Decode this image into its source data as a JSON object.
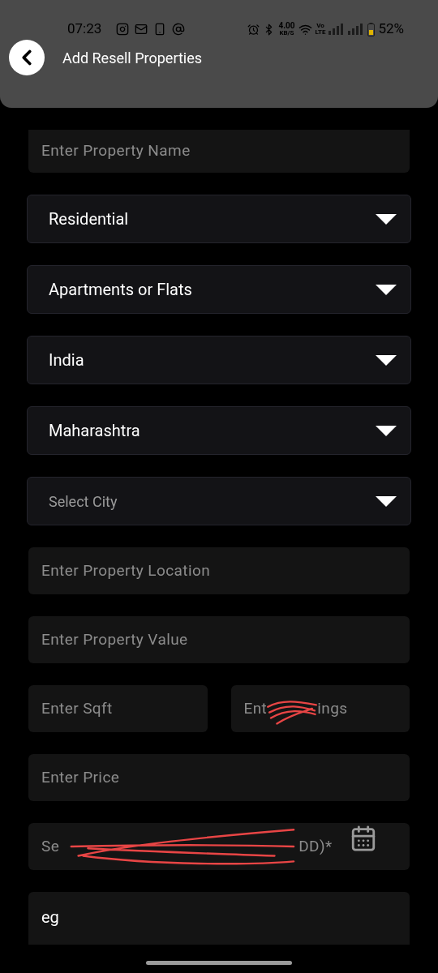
{
  "status_bar": {
    "time": "07:23",
    "speed_value": "4.00",
    "speed_unit": "KB/S",
    "volte_top": "Vo",
    "volte_bottom": "LTE",
    "battery": "52%"
  },
  "header": {
    "title": "Add Resell Properties"
  },
  "rows": [
    [
      {
        "kind": "text",
        "placeholder": "Enter Property Name",
        "clipped": true
      }
    ],
    [
      {
        "kind": "dropdown",
        "value": "Residential"
      }
    ],
    [
      {
        "kind": "dropdown",
        "value": "Apartments or Flats"
      }
    ],
    [
      {
        "kind": "dropdown",
        "value": "India"
      }
    ],
    [
      {
        "kind": "dropdown",
        "value": "Maharashtra"
      }
    ],
    [
      {
        "kind": "dropdown",
        "placeholder": "Select City"
      }
    ],
    [
      {
        "kind": "text",
        "placeholder": "Enter Property Location"
      }
    ],
    [
      {
        "kind": "text",
        "placeholder": "Enter Property Value"
      }
    ],
    [
      {
        "kind": "text",
        "placeholder": "Enter Sqft"
      },
      {
        "kind": "text",
        "placeholder_parts": [
          "Ent",
          "ings"
        ],
        "scribbled": true
      }
    ],
    [
      {
        "kind": "text",
        "placeholder": "Enter Price"
      }
    ],
    [
      {
        "kind": "date",
        "placeholder_parts": [
          "Se",
          "DD)*"
        ],
        "scribbled": true
      }
    ],
    [
      {
        "kind": "text",
        "value": "eg",
        "clipped": true
      }
    ]
  ]
}
